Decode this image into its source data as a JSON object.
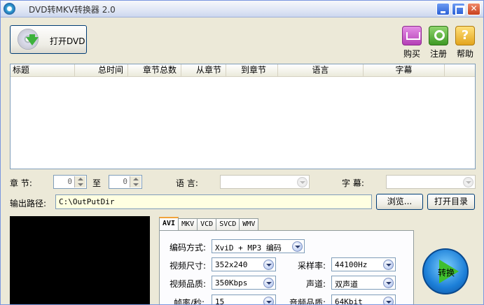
{
  "window": {
    "title": "DVD转MKV转换器 2.0"
  },
  "toolbar": {
    "open_dvd": "打开DVD",
    "buy": "购买",
    "register": "注册",
    "help": "帮助"
  },
  "list": {
    "columns": [
      "标题",
      "总时间",
      "章节总数",
      "从章节",
      "到章节",
      "语言",
      "字幕"
    ]
  },
  "chapter": {
    "label": "章    节:",
    "from_value": "0",
    "to_label": "至",
    "to_value": "0",
    "language_label": "语    言:",
    "subtitle_label": "字    幕:"
  },
  "output": {
    "label": "输出路径:",
    "path": "C:\\OutPutDir",
    "browse": "浏览...",
    "open_folder": "打开目录"
  },
  "tabs": [
    "AVI",
    "MKV",
    "VCD",
    "SVCD",
    "WMV"
  ],
  "settings": {
    "encoding_label": "编码方式:",
    "encoding_value": "XviD + MP3 编码",
    "video_size_label": "视频尺寸:",
    "video_size_value": "352x240",
    "video_quality_label": "视频品质:",
    "video_quality_value": "350Kbps",
    "frame_rate_label": "帧率/秒:",
    "frame_rate_value": "15",
    "sample_rate_label": "采样率:",
    "sample_rate_value": "44100Hz",
    "channel_label": "声道:",
    "channel_value": "双声道",
    "audio_quality_label": "音频品质:",
    "audio_quality_value": "64Kbit"
  },
  "convert": {
    "label": "转换"
  }
}
